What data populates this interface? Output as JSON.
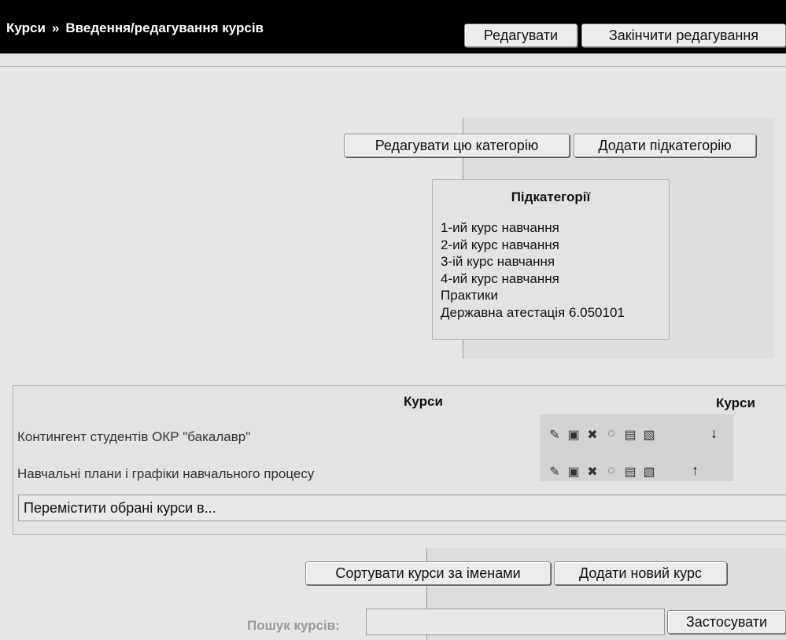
{
  "header": {
    "breadcrumb_root": "Курси",
    "breadcrumb_sep": "»",
    "breadcrumb_current": "Введення/редагування курсів",
    "edit_label": "Редагувати",
    "finish_edit_label": "Закінчити редагування"
  },
  "category": {
    "edit_category_label": "Редагувати цю категорію",
    "add_subcategory_label": "Додати підкатегорію"
  },
  "subcategories": {
    "title": "Підкатегорії",
    "items": [
      "1-ий курс навчання",
      "2-ий курс навчання",
      "3-ій курс навчання",
      "4-ий курс навчання",
      "Практики",
      "Державна атестація 6.050101"
    ]
  },
  "courses": {
    "header_left": "Курси",
    "header_right": "Курси",
    "rows": [
      "Контингент студентів ОКР \"бакалавр\"",
      "Навчальні плани і графіки навчального процесу"
    ],
    "move_select": "Перемістити обрані курси в..."
  },
  "bottom": {
    "sort_label": "Сортувати курси за іменами",
    "add_course_label": "Додати новий курс",
    "search_label": "Пошук курсів:",
    "search_value": "",
    "apply_label": "Застосувати"
  },
  "icons": {
    "row_icons": [
      "edit-icon",
      "enrol-icon",
      "delete-icon",
      "hide-icon",
      "backup-icon",
      "restore-icon"
    ],
    "row1_move": "move-down-icon",
    "row2_move": "move-up-icon"
  }
}
